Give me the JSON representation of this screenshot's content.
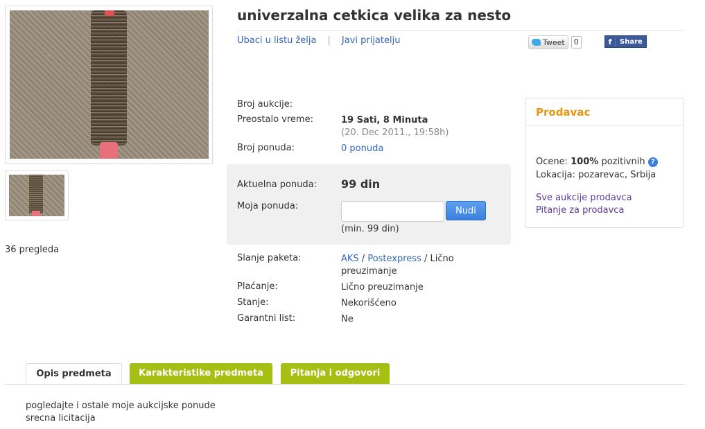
{
  "product": {
    "title": "univerzalna cetkica velika za nesto",
    "views": "36 pregleda"
  },
  "actions": {
    "wishlist": "Ubaci u listu želja",
    "separator": "|",
    "tell_friend": "Javi prijatelju"
  },
  "social": {
    "tweet_label": "Tweet",
    "tweet_count": "0",
    "share_label": "Share"
  },
  "details": {
    "auction_number_label": "Broj aukcije:",
    "auction_number_value": "",
    "time_left_label": "Preostalo vreme:",
    "time_left_value": "19 Sati, 8 Minuta",
    "end_date": "(20. Dec 2011., 19:58h)",
    "bids_count_label": "Broj ponuda:",
    "bids_count_value": "0 ponuda"
  },
  "bid": {
    "current_label": "Aktuelna ponuda:",
    "current_value": "99 din",
    "my_bid_label": "Moja ponuda:",
    "input_value": "",
    "button_label": "Nudi",
    "min_note": "(min. 99 din)"
  },
  "shipping": {
    "label": "Slanje paketa:",
    "option1": "AKS",
    "slash1": " / ",
    "option2": "Postexpress",
    "slash2": " / ",
    "option3_line1": "Lično",
    "option3_line2": "preuzimanje"
  },
  "payment": {
    "label": "Plaćanje:",
    "value": "Lično preuzimanje"
  },
  "condition": {
    "label": "Stanje:",
    "value": "Nekorišćeno"
  },
  "warranty": {
    "label": "Garantni list:",
    "value": "Ne"
  },
  "seller": {
    "title": "Prodavac",
    "rating_label": "Ocene:",
    "rating_value": "100%",
    "rating_suffix": "pozitivnih",
    "help_icon": "?",
    "location_label": "Lokacija:",
    "location_value": "pozarevac, Srbija",
    "all_auctions_link": "Sve aukcije prodavca",
    "question_link": "Pitanje za prodavca"
  },
  "tabs": [
    {
      "label": "Opis predmeta"
    },
    {
      "label": "Karakteristike predmeta"
    },
    {
      "label": "Pitanja i odgovori"
    }
  ],
  "description": {
    "line1": "pogledajte i ostale moje aukcijske ponude",
    "line2": "srecna licitacija"
  },
  "colors": {
    "link": "#3366bb",
    "seller_title": "#e8960c",
    "tab_inactive": "#a5bf12",
    "button": "#3a7fdc",
    "seller_link": "#5b3a9a"
  }
}
